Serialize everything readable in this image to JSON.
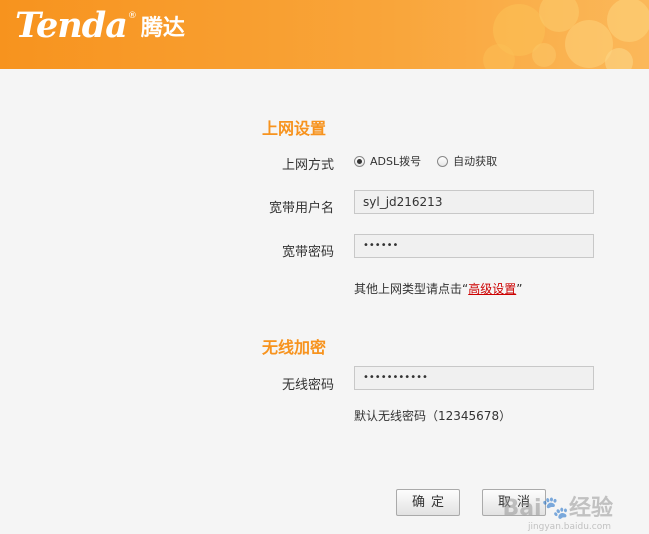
{
  "header": {
    "logo_en": "Tenda",
    "logo_reg": "®",
    "logo_cn": "腾达",
    "color": "#f7931e"
  },
  "internet": {
    "section_title": "上网设置",
    "connection_label": "上网方式",
    "options": [
      {
        "label": "ADSL拨号",
        "checked": true
      },
      {
        "label": "自动获取",
        "checked": false
      }
    ],
    "username_label": "宽带用户名",
    "username_value": "syl_jd216213",
    "password_label": "宽带密码",
    "password_value": "••••••",
    "hint_prefix": "其他上网类型请点击“",
    "hint_link": "高级设置",
    "hint_suffix": "”"
  },
  "wireless": {
    "section_title": "无线加密",
    "password_label": "无线密码",
    "password_value": "•••••••••••",
    "default_hint": "默认无线密码（12345678）"
  },
  "buttons": {
    "ok_label": "确定",
    "cancel_label": "取消"
  },
  "watermark": {
    "text": "Bai🐾经验",
    "sub": "jingyan.baidu.com"
  }
}
